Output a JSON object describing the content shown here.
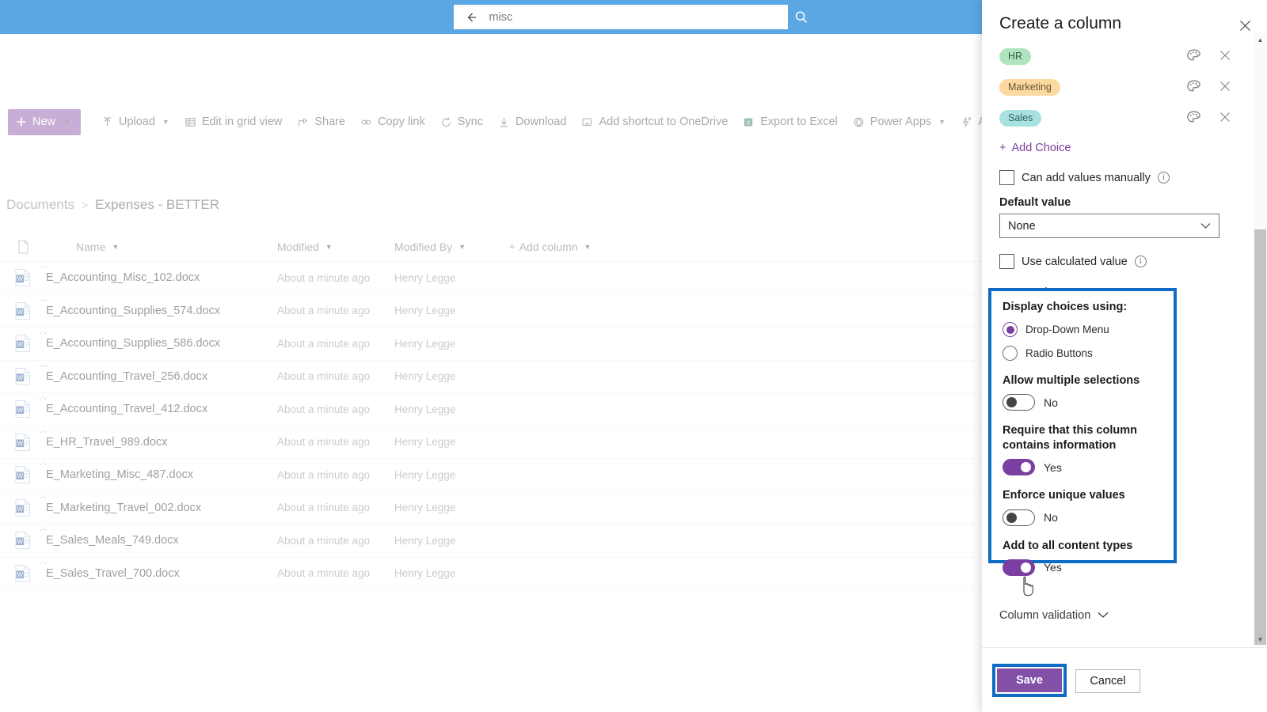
{
  "search": {
    "value": "misc",
    "back_icon": "back-arrow-icon",
    "go_icon": "search-icon"
  },
  "commandbar": {
    "new_label": "New",
    "items": [
      {
        "label": "Upload",
        "icon": "upload-icon",
        "caret": true
      },
      {
        "label": "Edit in grid view",
        "icon": "grid-icon",
        "caret": false
      },
      {
        "label": "Share",
        "icon": "share-icon",
        "caret": false
      },
      {
        "label": "Copy link",
        "icon": "link-icon",
        "caret": false
      },
      {
        "label": "Sync",
        "icon": "sync-icon",
        "caret": false
      },
      {
        "label": "Download",
        "icon": "download-icon",
        "caret": false
      },
      {
        "label": "Add shortcut to OneDrive",
        "icon": "onedrive-shortcut-icon",
        "caret": false
      },
      {
        "label": "Export to Excel",
        "icon": "excel-icon",
        "caret": false
      },
      {
        "label": "Power Apps",
        "icon": "power-apps-icon",
        "caret": true
      },
      {
        "label": "Automate",
        "icon": "automate-icon",
        "caret": true
      }
    ]
  },
  "breadcrumb": {
    "root": "Documents",
    "separator": ">",
    "current": "Expenses - BETTER"
  },
  "list": {
    "headers": {
      "name": "Name",
      "modified": "Modified",
      "modified_by": "Modified By",
      "add_column": "Add column"
    },
    "rows": [
      {
        "name": "E_Accounting_Misc_102.docx",
        "modified": "About a minute ago",
        "modified_by": "Henry Legge"
      },
      {
        "name": "E_Accounting_Supplies_574.docx",
        "modified": "About a minute ago",
        "modified_by": "Henry Legge"
      },
      {
        "name": "E_Accounting_Supplies_586.docx",
        "modified": "About a minute ago",
        "modified_by": "Henry Legge"
      },
      {
        "name": "E_Accounting_Travel_256.docx",
        "modified": "About a minute ago",
        "modified_by": "Henry Legge"
      },
      {
        "name": "E_Accounting_Travel_412.docx",
        "modified": "About a minute ago",
        "modified_by": "Henry Legge"
      },
      {
        "name": "E_HR_Travel_989.docx",
        "modified": "About a minute ago",
        "modified_by": "Henry Legge"
      },
      {
        "name": "E_Marketing_Misc_487.docx",
        "modified": "About a minute ago",
        "modified_by": "Henry Legge"
      },
      {
        "name": "E_Marketing_Travel_002.docx",
        "modified": "About a minute ago",
        "modified_by": "Henry Legge"
      },
      {
        "name": "E_Sales_Meals_749.docx",
        "modified": "About a minute ago",
        "modified_by": "Henry Legge"
      },
      {
        "name": "E_Sales_Travel_700.docx",
        "modified": "About a minute ago",
        "modified_by": "Henry Legge"
      }
    ]
  },
  "panel": {
    "title": "Create a column",
    "close_icon": "close-icon",
    "choices": [
      {
        "label": "HR",
        "bg": "#aee5bf",
        "fg": "#3a5a42"
      },
      {
        "label": "Marketing",
        "bg": "#fbd9a0",
        "fg": "#6a5430"
      },
      {
        "label": "Sales",
        "bg": "#a7e2e0",
        "fg": "#356160"
      }
    ],
    "choice_palette_icon": "palette-icon",
    "choice_remove_icon": "close-icon",
    "add_choice": "Add Choice",
    "can_add_values": {
      "label": "Can add values manually",
      "checked": false
    },
    "default_value": {
      "label": "Default value",
      "value": "None"
    },
    "use_calculated": {
      "label": "Use calculated value",
      "checked": false
    },
    "more_options": "More options",
    "options": {
      "display_title": "Display choices using:",
      "radios": [
        {
          "label": "Drop-Down Menu",
          "selected": true
        },
        {
          "label": "Radio Buttons",
          "selected": false
        }
      ],
      "toggles": [
        {
          "label": "Allow multiple selections",
          "value": "No",
          "on": false
        },
        {
          "label": "Require that this column contains information",
          "value": "Yes",
          "on": true
        },
        {
          "label": "Enforce unique values",
          "value": "No",
          "on": false
        },
        {
          "label": "Add to all content types",
          "value": "Yes",
          "on": true
        }
      ]
    },
    "column_validation": "Column validation",
    "save_label": "Save",
    "cancel_label": "Cancel"
  },
  "colors": {
    "header_blue": "#5ba7e4",
    "accent_purple": "#7a3fa0",
    "highlight_blue": "#0f6bc4",
    "save_purple": "#8350a8"
  }
}
